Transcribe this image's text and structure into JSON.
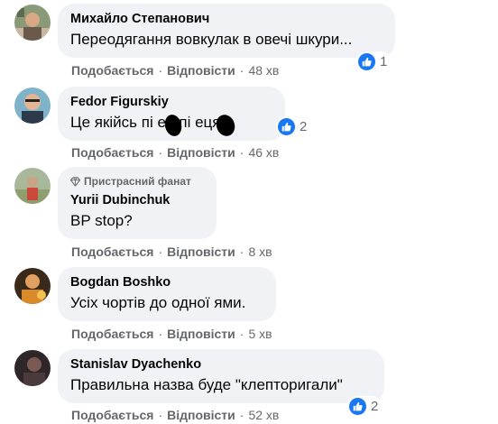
{
  "comments": [
    {
      "author": "Михайло Степанович",
      "text": "Переодягання вовкулак в овечі шкури...",
      "reaction_count": "1",
      "like_label": "Подобається",
      "reply_label": "Відповісти",
      "time": "48 хв"
    },
    {
      "author": "Fedor Figurskiy",
      "text": "Це якійсь пі  ец пі  еця!!",
      "reaction_count": "2",
      "like_label": "Подобається",
      "reply_label": "Відповісти",
      "time": "46 хв"
    },
    {
      "badge": "Пристрасний фанат",
      "author": "Yurii Dubinchuk",
      "text": "BP stop?",
      "like_label": "Подобається",
      "reply_label": "Відповісти",
      "time": "8 хв"
    },
    {
      "author": "Bogdan Boshko",
      "text": "Усіх чортів до одної ями.",
      "like_label": "Подобається",
      "reply_label": "Відповісти",
      "time": "5 хв"
    },
    {
      "author": "Stanislav Dyachenko",
      "text": "Правильна назва буде \"клепторигали\"",
      "reaction_count": "2",
      "like_label": "Подобається",
      "reply_label": "Відповісти",
      "time": "52 хв"
    }
  ],
  "separator": "·",
  "icons": {
    "reaction": "like-icon",
    "badge": "diamond-icon"
  },
  "colors": {
    "like_blue": "#1877f2",
    "bubble_bg": "#f0f2f5",
    "secondary_text": "#65676b"
  }
}
